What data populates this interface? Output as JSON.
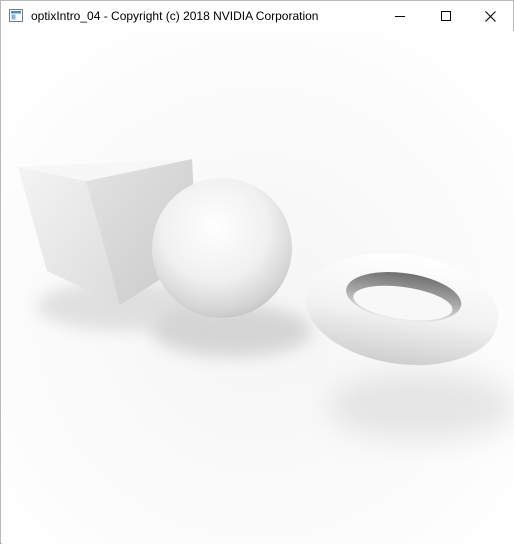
{
  "window": {
    "title": "optixIntro_04 - Copyright (c) 2018 NVIDIA Corporation",
    "icon": "application-icon",
    "controls": [
      "minimize-icon",
      "maximize-icon",
      "close-icon"
    ]
  },
  "scene": {
    "objects": [
      "box",
      "sphere",
      "torus",
      "ground-plane"
    ],
    "background_color": "#ffffff"
  }
}
